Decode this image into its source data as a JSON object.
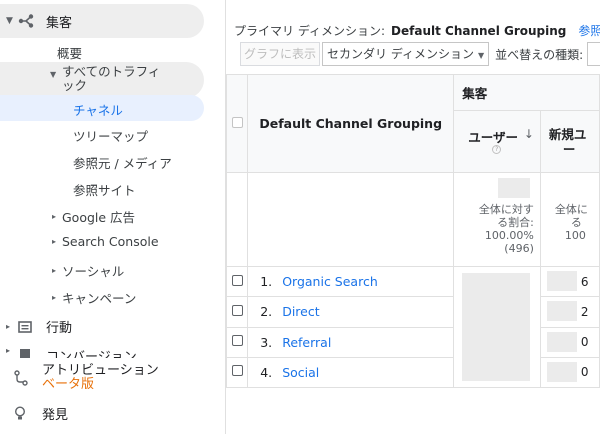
{
  "sidebar": {
    "acquisition": "集客",
    "overview": "概要",
    "all_traffic": [
      "すべてのトラフィ",
      "ック"
    ],
    "channels": "チャネル",
    "treemap": "ツリーマップ",
    "source_medium": "参照元 / メディア",
    "referrals": "参照サイト",
    "google_ads": "Google 広告",
    "search_console": "Search Console",
    "social": "ソーシャル",
    "campaigns": "キャンペーン",
    "behavior": "行動",
    "conversions": "コンバージョン",
    "attribution": "アトリビューション",
    "attribution_beta": "ベータ版",
    "discover": "発見"
  },
  "dimension_bar": {
    "label": "プライマリ ディメンション:",
    "current": "Default Channel Grouping",
    "link": "参照元/メ"
  },
  "toolbar": {
    "plot_rows": "グラフに表示",
    "secondary_dimension": "セカンダリ ディメンション",
    "sort_type": "並べ替えの種類:"
  },
  "table": {
    "group_header": "集客",
    "dimension_header": "Default Channel Grouping",
    "metric_users": "ユーザー",
    "metric_new_users": [
      "新規ユ",
      "ー"
    ],
    "totals_users": [
      "全体に対す",
      "る割合:",
      "100.00%",
      "(496)"
    ],
    "totals_new_users": [
      "全体に",
      "る",
      "100"
    ],
    "rows": [
      {
        "num": "1.",
        "label": "Organic Search",
        "new_users_clip": "6"
      },
      {
        "num": "2.",
        "label": "Direct",
        "new_users_clip": "2"
      },
      {
        "num": "3.",
        "label": "Referral",
        "new_users_clip": "0"
      },
      {
        "num": "4.",
        "label": "Social",
        "new_users_clip": "0"
      }
    ]
  },
  "colors": {
    "accent": "#1a73e8",
    "active_bg": "#e8f0fe",
    "beta": "#e8710a"
  }
}
